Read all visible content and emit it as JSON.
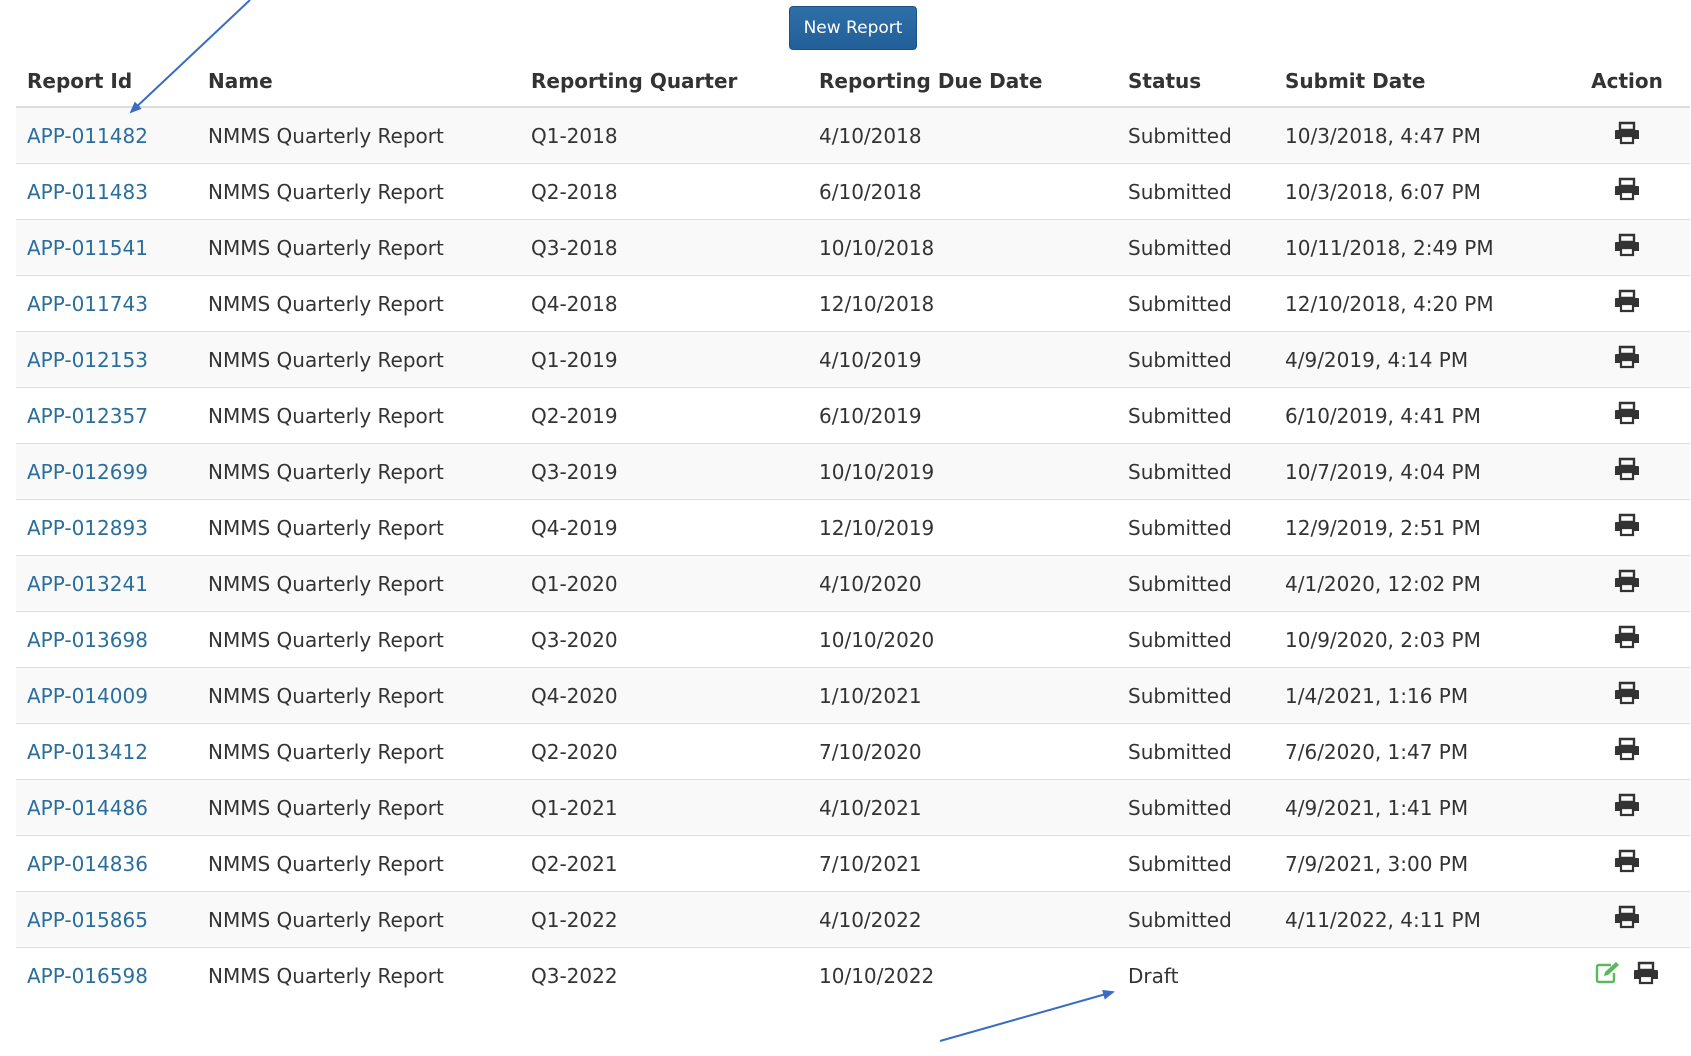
{
  "toolbar": {
    "new_report_label": "New Report"
  },
  "table": {
    "headers": {
      "report_id": "Report Id",
      "name": "Name",
      "quarter": "Reporting Quarter",
      "due_date": "Reporting Due Date",
      "status": "Status",
      "submit_date": "Submit Date",
      "action": "Action"
    },
    "rows": [
      {
        "id": "APP-011482",
        "name": "NMMS Quarterly Report",
        "quarter": "Q1-2018",
        "due": "4/10/2018",
        "status": "Submitted",
        "submit": "10/3/2018, 4:47 PM"
      },
      {
        "id": "APP-011483",
        "name": "NMMS Quarterly Report",
        "quarter": "Q2-2018",
        "due": "6/10/2018",
        "status": "Submitted",
        "submit": "10/3/2018, 6:07 PM"
      },
      {
        "id": "APP-011541",
        "name": "NMMS Quarterly Report",
        "quarter": "Q3-2018",
        "due": "10/10/2018",
        "status": "Submitted",
        "submit": "10/11/2018, 2:49 PM"
      },
      {
        "id": "APP-011743",
        "name": "NMMS Quarterly Report",
        "quarter": "Q4-2018",
        "due": "12/10/2018",
        "status": "Submitted",
        "submit": "12/10/2018, 4:20 PM"
      },
      {
        "id": "APP-012153",
        "name": "NMMS Quarterly Report",
        "quarter": "Q1-2019",
        "due": "4/10/2019",
        "status": "Submitted",
        "submit": "4/9/2019, 4:14 PM"
      },
      {
        "id": "APP-012357",
        "name": "NMMS Quarterly Report",
        "quarter": "Q2-2019",
        "due": "6/10/2019",
        "status": "Submitted",
        "submit": "6/10/2019, 4:41 PM"
      },
      {
        "id": "APP-012699",
        "name": "NMMS Quarterly Report",
        "quarter": "Q3-2019",
        "due": "10/10/2019",
        "status": "Submitted",
        "submit": "10/7/2019, 4:04 PM"
      },
      {
        "id": "APP-012893",
        "name": "NMMS Quarterly Report",
        "quarter": "Q4-2019",
        "due": "12/10/2019",
        "status": "Submitted",
        "submit": "12/9/2019, 2:51 PM"
      },
      {
        "id": "APP-013241",
        "name": "NMMS Quarterly Report",
        "quarter": "Q1-2020",
        "due": "4/10/2020",
        "status": "Submitted",
        "submit": "4/1/2020, 12:02 PM"
      },
      {
        "id": "APP-013698",
        "name": "NMMS Quarterly Report",
        "quarter": "Q3-2020",
        "due": "10/10/2020",
        "status": "Submitted",
        "submit": "10/9/2020, 2:03 PM"
      },
      {
        "id": "APP-014009",
        "name": "NMMS Quarterly Report",
        "quarter": "Q4-2020",
        "due": "1/10/2021",
        "status": "Submitted",
        "submit": "1/4/2021, 1:16 PM"
      },
      {
        "id": "APP-013412",
        "name": "NMMS Quarterly Report",
        "quarter": "Q2-2020",
        "due": "7/10/2020",
        "status": "Submitted",
        "submit": "7/6/2020, 1:47 PM"
      },
      {
        "id": "APP-014486",
        "name": "NMMS Quarterly Report",
        "quarter": "Q1-2021",
        "due": "4/10/2021",
        "status": "Submitted",
        "submit": "4/9/2021, 1:41 PM"
      },
      {
        "id": "APP-014836",
        "name": "NMMS Quarterly Report",
        "quarter": "Q2-2021",
        "due": "7/10/2021",
        "status": "Submitted",
        "submit": "7/9/2021, 3:00 PM"
      },
      {
        "id": "APP-015865",
        "name": "NMMS Quarterly Report",
        "quarter": "Q1-2022",
        "due": "4/10/2022",
        "status": "Submitted",
        "submit": "4/11/2022, 4:11 PM"
      },
      {
        "id": "APP-016598",
        "name": "NMMS Quarterly Report",
        "quarter": "Q3-2022",
        "due": "10/10/2022",
        "status": "Draft",
        "submit": "",
        "editable": true
      }
    ]
  },
  "icons": {
    "print": "print-icon",
    "edit": "edit-icon",
    "arrow": "annotation-arrow"
  },
  "colors": {
    "link": "#2a6e9e",
    "button": "#2a67a0",
    "stripe": "#f9f9f9",
    "edit_icon": "#5cb85c",
    "arrow": "#3a6cc4"
  }
}
